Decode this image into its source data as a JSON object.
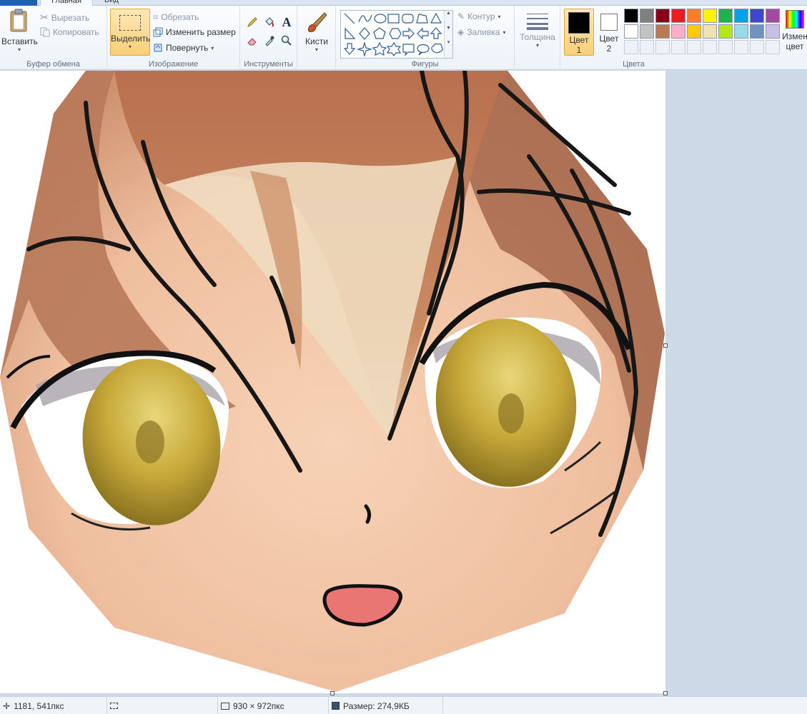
{
  "tabs": {
    "main": "Главная",
    "view": "Вид"
  },
  "clipboard": {
    "group_label": "Буфер обмена",
    "paste": "Вставить",
    "cut": "Вырезать",
    "copy": "Копировать"
  },
  "image": {
    "group_label": "Изображение",
    "select": "Выделить",
    "crop": "Обрезать",
    "resize": "Изменить размер",
    "rotate": "Повернуть"
  },
  "tools": {
    "group_label": "Инструменты"
  },
  "brushes": {
    "label": "Кисти"
  },
  "shapes": {
    "group_label": "Фигуры",
    "outline": "Контур",
    "fill": "Заливка"
  },
  "thickness": {
    "label": "Толщина"
  },
  "color1": {
    "label_line1": "Цвет",
    "label_line2": "1",
    "value": "#000000"
  },
  "color2": {
    "label_line1": "Цвет",
    "label_line2": "2",
    "value": "#ffffff"
  },
  "colors": {
    "group_label": "Цвета",
    "edit_label_line1": "Измен",
    "edit_label_line2": "цвет",
    "palette_row1": [
      "#000000",
      "#7f7f7f",
      "#880015",
      "#ed1c24",
      "#ff7f27",
      "#fff200",
      "#22b14c",
      "#00a2e8",
      "#3f48cc",
      "#a349a4"
    ],
    "palette_row2": [
      "#ffffff",
      "#c3c3c3",
      "#b97a57",
      "#ffaec9",
      "#ffc90e",
      "#efe4b0",
      "#b5e61d",
      "#99d9ea",
      "#7092be",
      "#c8bfe7"
    ]
  },
  "status": {
    "cursor_pos": "1181, 541пкс",
    "image_size": "930 × 972пкс",
    "file_size": "Размер: 274,9КБ"
  }
}
